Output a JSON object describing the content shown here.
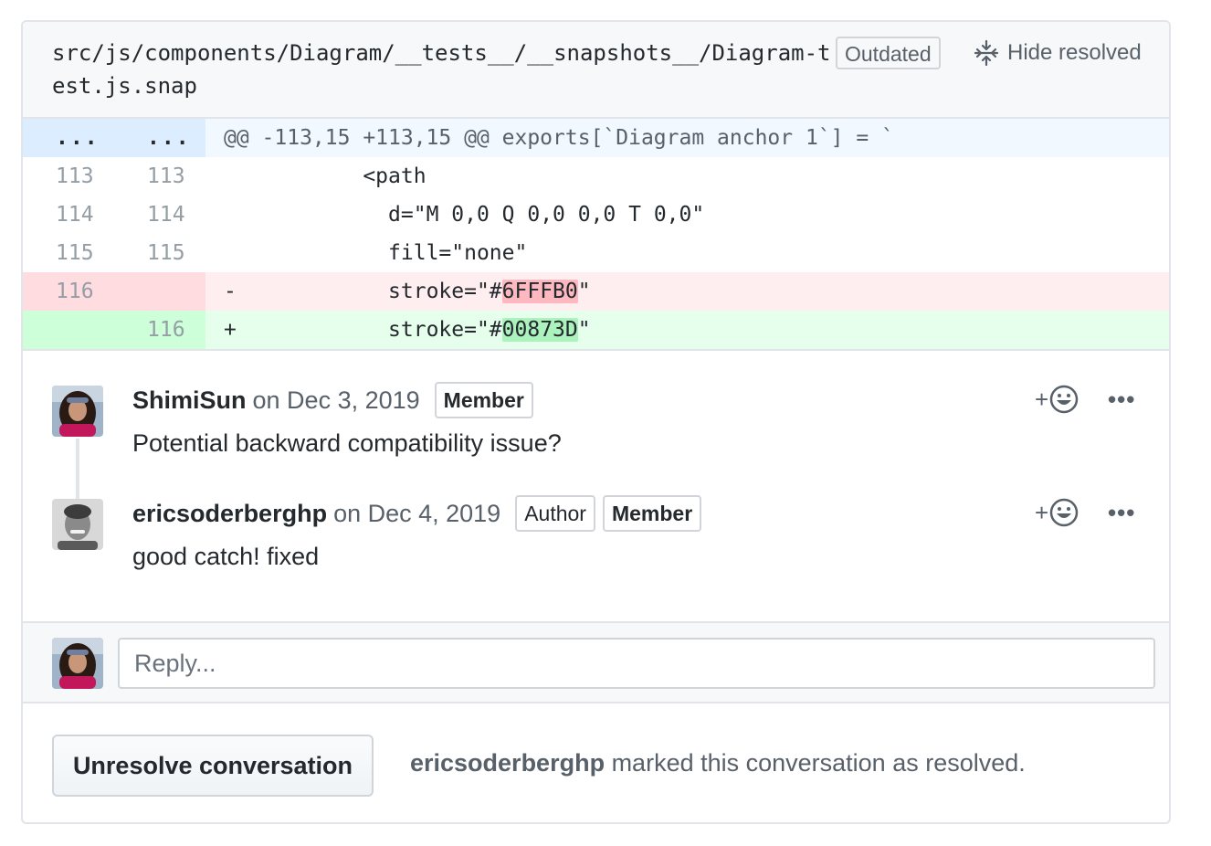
{
  "file": {
    "path": "src/js/components/Diagram/__tests__/__snapshots__/Diagram-test.js.snap",
    "outdated_label": "Outdated",
    "hide_resolved_label": "Hide resolved"
  },
  "diff": {
    "hunk": {
      "left": "...",
      "right": "...",
      "text": "@@ -113,15 +113,15 @@ exports[`Diagram anchor 1`] = `"
    },
    "lines": [
      {
        "type": "context",
        "old": "113",
        "new": "113",
        "sign": " ",
        "code": "          <path"
      },
      {
        "type": "context",
        "old": "114",
        "new": "114",
        "sign": " ",
        "code": "            d=\"M 0,0 Q 0,0 0,0 T 0,0\""
      },
      {
        "type": "context",
        "old": "115",
        "new": "115",
        "sign": " ",
        "code": "            fill=\"none\""
      }
    ],
    "deleted": {
      "old": "116",
      "new": "",
      "sign": "-",
      "prefix": "            stroke=\"#",
      "highlight": "6FFFB0",
      "suffix": "\""
    },
    "added": {
      "old": "",
      "new": "116",
      "sign": "+",
      "prefix": "            stroke=\"#",
      "highlight": "00873D",
      "suffix": "\""
    }
  },
  "comments": [
    {
      "author": "ShimiSun",
      "date": "on Dec 3, 2019",
      "badges": [
        "Member"
      ],
      "body": "Potential backward compatibility issue?"
    },
    {
      "author": "ericsoderberghp",
      "date": "on Dec 4, 2019",
      "badges": [
        "Author",
        "Member"
      ],
      "body": "good catch! fixed"
    }
  ],
  "reaction_plus": "+",
  "more_label": "•••",
  "reply": {
    "placeholder": "Reply..."
  },
  "footer": {
    "button_label": "Unresolve conversation",
    "resolver": "ericsoderberghp",
    "message": " marked this conversation as resolved."
  },
  "colors": {
    "deleted_bg": "#ffeef0",
    "added_bg": "#e6ffed",
    "hunk_bg": "#f1f8ff"
  }
}
